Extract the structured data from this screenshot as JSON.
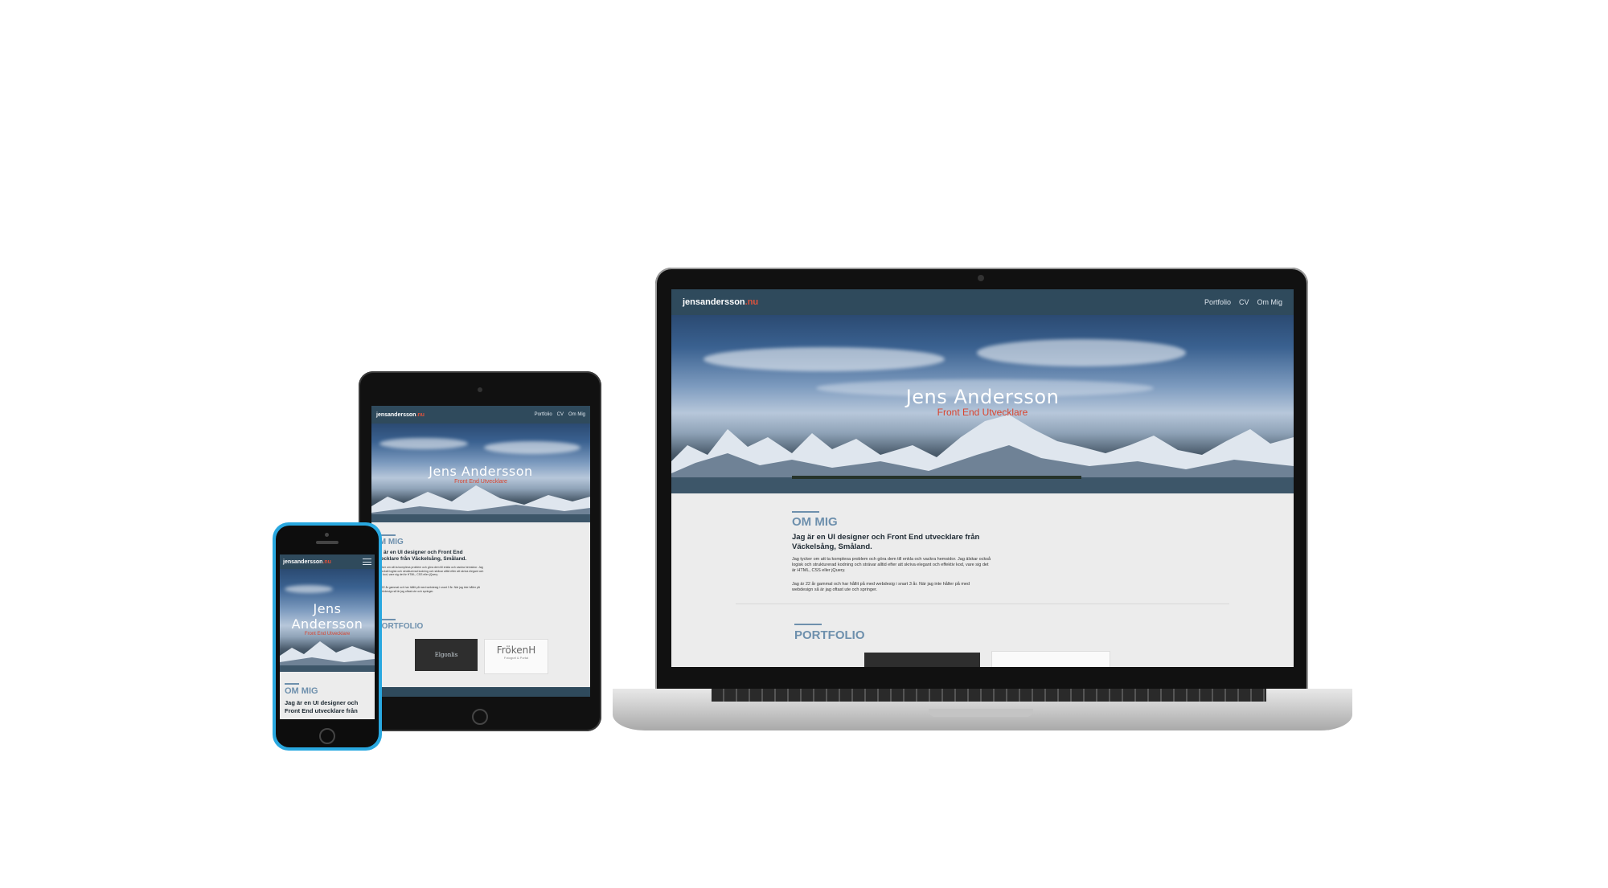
{
  "site": {
    "logo_main": "jensandersson",
    "logo_tld": ".nu",
    "nav": {
      "portfolio": "Portfolio",
      "cv": "CV",
      "about": "Om Mig"
    },
    "hero_name": "Jens Andersson",
    "hero_subtitle": "Front End Utvecklare",
    "phone_hero_name_line1": "Jens",
    "phone_hero_name_line2": "Andersson",
    "about_title": "OM MIG",
    "about_lead": "Jag är en UI designer och Front End utvecklare från Väckelsång, Småland.",
    "phone_about_lead": "Jag är en UI designer och Front End utvecklare från",
    "about_p1": "Jag tycker om att ta komplexa problem och göra dem till enkla och vackra hemsidor. Jag älskar också logisk och strukturerad kodning och strävar alltid efter att skriva elegant och effektiv kod, vare sig det är HTML, CSS eller jQuery.",
    "about_p2": "Jag är 22 år gammal och har hållit på med webdesig i snart 3 år. När jag inte håller på med webdesign så är jag oftast ute och springer.",
    "portfolio_title": "PORTFOLIO",
    "portfolio_items": [
      {
        "label": "Elgonlis"
      },
      {
        "label": "FrökenH",
        "sub": "Fotograf & Portal"
      }
    ]
  },
  "colors": {
    "nav_bg": "#2f4a5c",
    "accent_red": "#d9442e",
    "section_blue": "#6e90ad",
    "phone_frame": "#29a8e0"
  },
  "icons": [
    "menu-icon"
  ]
}
